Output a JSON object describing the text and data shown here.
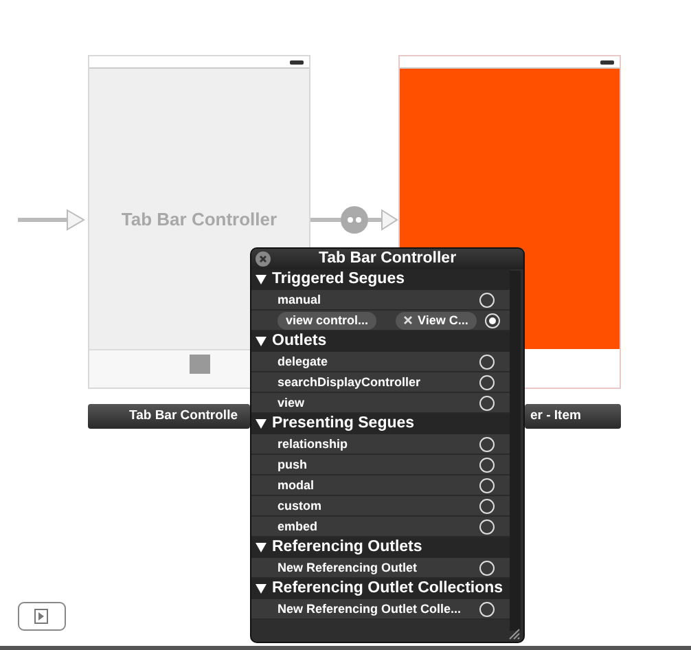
{
  "scenes": [
    {
      "title": "Tab Bar Controller",
      "kind": "tabbar",
      "label": "Tab Bar Controlle"
    },
    {
      "kind": "orange",
      "color": "#ff5000",
      "label": "er - Item"
    }
  ],
  "popup": {
    "title": "Tab Bar Controller",
    "sections": [
      {
        "title": "Triggered Segues",
        "expanded": true,
        "rows": [
          {
            "label": "manual",
            "connected": false
          },
          {
            "label": "view control...",
            "connected": true,
            "target": "View C..."
          }
        ]
      },
      {
        "title": "Outlets",
        "expanded": true,
        "rows": [
          {
            "label": "delegate",
            "connected": false
          },
          {
            "label": "searchDisplayController",
            "connected": false
          },
          {
            "label": "view",
            "connected": false
          }
        ]
      },
      {
        "title": "Presenting Segues",
        "expanded": true,
        "rows": [
          {
            "label": "relationship",
            "connected": false
          },
          {
            "label": "push",
            "connected": false
          },
          {
            "label": "modal",
            "connected": false
          },
          {
            "label": "custom",
            "connected": false
          },
          {
            "label": "embed",
            "connected": false
          }
        ]
      },
      {
        "title": "Referencing Outlets",
        "expanded": true,
        "rows": [
          {
            "label": "New Referencing Outlet",
            "connected": false
          }
        ]
      },
      {
        "title": "Referencing Outlet Collections",
        "expanded": true,
        "rows": [
          {
            "label": "New Referencing Outlet Colle...",
            "connected": false
          }
        ]
      }
    ]
  }
}
